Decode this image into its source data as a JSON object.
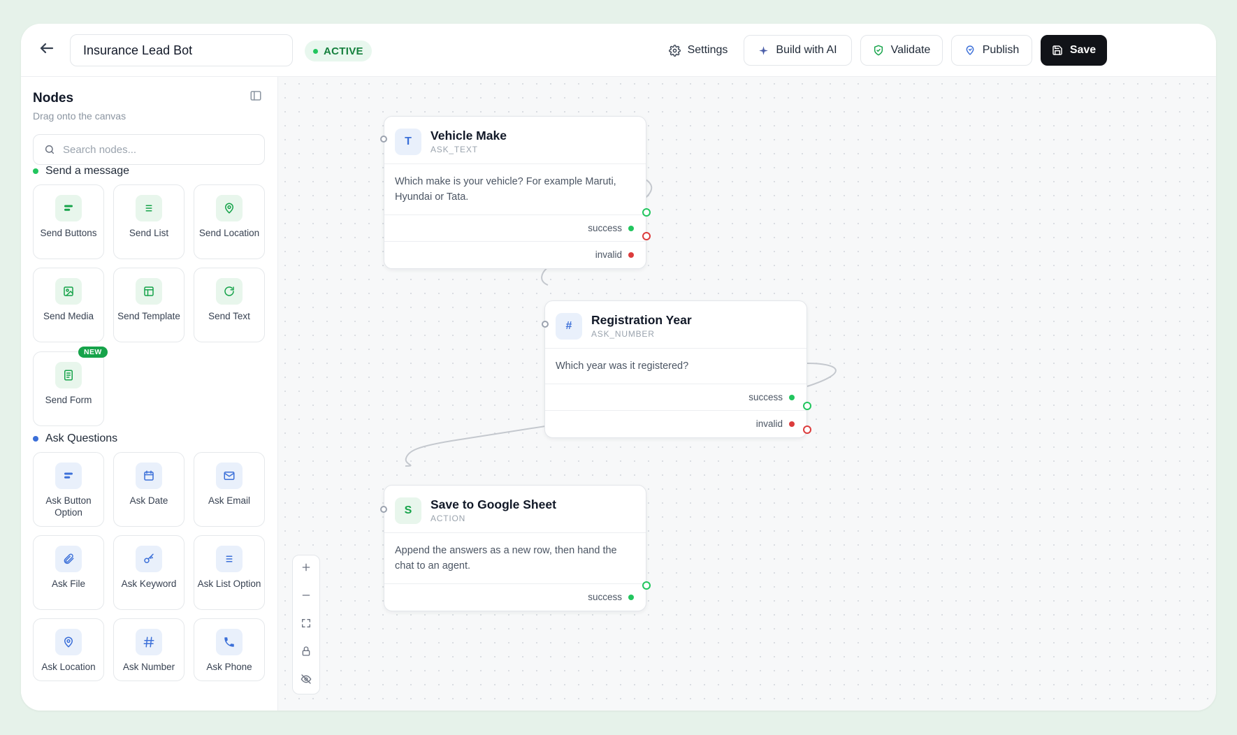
{
  "header": {
    "back_icon": "arrow-left-icon",
    "bot_name": "Insurance Lead Bot",
    "status": "ACTIVE",
    "settings_label": "Settings",
    "build_ai_label": "Build with AI",
    "validate_label": "Validate",
    "publish_label": "Publish",
    "save_label": "Save"
  },
  "sidebar": {
    "title": "Nodes",
    "subtitle": "Drag onto the canvas",
    "search_placeholder": "Search nodes...",
    "sections": [
      {
        "label": "Send a message",
        "color": "#22c55e",
        "items": [
          {
            "label": "Send Buttons",
            "icon": "buttons-icon"
          },
          {
            "label": "Send List",
            "icon": "list-icon"
          },
          {
            "label": "Send Location",
            "icon": "location-pin-icon"
          },
          {
            "label": "Send Media",
            "icon": "image-icon"
          },
          {
            "label": "Send Template",
            "icon": "template-icon"
          },
          {
            "label": "Send Text",
            "icon": "refresh-icon"
          },
          {
            "label": "Send Form",
            "icon": "form-icon",
            "badge": "NEW"
          }
        ]
      },
      {
        "label": "Ask Questions",
        "color": "#3b6fd8",
        "items": [
          {
            "label": "Ask Button Option",
            "icon": "buttons-icon"
          },
          {
            "label": "Ask Date",
            "icon": "calendar-icon"
          },
          {
            "label": "Ask Email",
            "icon": "mail-icon"
          },
          {
            "label": "Ask File",
            "icon": "paperclip-icon"
          },
          {
            "label": "Ask Keyword",
            "icon": "key-icon"
          },
          {
            "label": "Ask List Option",
            "icon": "list-icon"
          },
          {
            "label": "Ask Location",
            "icon": "location-pin-icon"
          },
          {
            "label": "Ask Number",
            "icon": "hash-icon"
          },
          {
            "label": "Ask Phone",
            "icon": "phone-icon"
          }
        ]
      }
    ]
  },
  "canvas": {
    "nodes": [
      {
        "title": "Vehicle Make",
        "type": "ASK_TEXT",
        "icon_letter": "T",
        "body": "Which make is your vehicle? For example Maruti, Hyundai or Tata.",
        "ports": [
          {
            "label": "success",
            "status": "green"
          },
          {
            "label": "invalid",
            "status": "red"
          }
        ]
      },
      {
        "title": "Registration Year",
        "type": "ASK_NUMBER",
        "icon_letter": "#",
        "body": "Which year was it registered?",
        "ports": [
          {
            "label": "success",
            "status": "green"
          },
          {
            "label": "invalid",
            "status": "red"
          }
        ]
      },
      {
        "title": "Save to Google Sheet",
        "type": "ACTION",
        "icon_letter": "S",
        "body": "Append the answers as a new row, then hand the chat to an agent.",
        "ports": [
          {
            "label": "success",
            "status": "green"
          }
        ]
      }
    ],
    "zoom_controls": [
      "zoom-in-icon",
      "zoom-out-icon",
      "fit-view-icon",
      "lock-icon",
      "hide-icon"
    ]
  },
  "colors": {
    "accent_green": "#16a34a",
    "accent_blue": "#3b6fd8",
    "error_red": "#dc3c3c",
    "dark_button": "#111318"
  }
}
